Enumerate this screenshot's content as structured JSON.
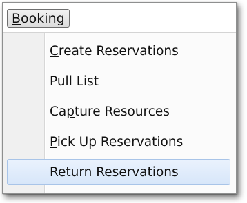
{
  "menubar": {
    "menu": {
      "accel": "B",
      "rest": "ooking"
    }
  },
  "menu": {
    "items": [
      {
        "pre": "",
        "accel": "C",
        "post": "reate Reservations",
        "highlighted": false
      },
      {
        "pre": "Pull ",
        "accel": "L",
        "post": "ist",
        "highlighted": false
      },
      {
        "pre": "Ca",
        "accel": "p",
        "post": "ture Resources",
        "highlighted": false
      },
      {
        "pre": "",
        "accel": "P",
        "post": "ick Up Reservations",
        "highlighted": false
      },
      {
        "pre": "",
        "accel": "R",
        "post": "eturn Reservations",
        "highlighted": true
      }
    ]
  },
  "colors": {
    "highlight_border": "#a8c4e8",
    "highlight_fill": "#dde9fa",
    "panel_background": "#f0f0f0"
  }
}
